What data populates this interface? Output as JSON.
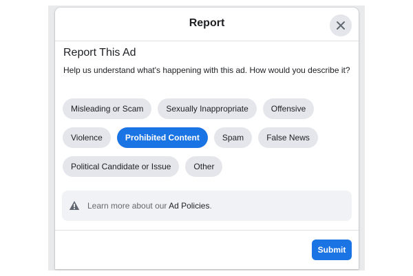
{
  "dialog": {
    "title": "Report",
    "close_icon": "close-icon"
  },
  "section": {
    "title": "Report This Ad",
    "description": "Help us understand what's happening with this ad. How would you describe it?"
  },
  "options": [
    {
      "label": "Misleading or Scam",
      "selected": false
    },
    {
      "label": "Sexually Inappropriate",
      "selected": false
    },
    {
      "label": "Offensive",
      "selected": false
    },
    {
      "label": "Violence",
      "selected": false
    },
    {
      "label": "Prohibited Content",
      "selected": true
    },
    {
      "label": "Spam",
      "selected": false
    },
    {
      "label": "False News",
      "selected": false
    },
    {
      "label": "Political Candidate or Issue",
      "selected": false
    },
    {
      "label": "Other",
      "selected": false
    }
  ],
  "info": {
    "icon": "warning-icon",
    "prefix": "Learn more about our ",
    "link": "Ad Policies",
    "suffix": "."
  },
  "footer": {
    "submit_label": "Submit"
  },
  "colors": {
    "accent": "#1b74e4",
    "chip_bg": "#e4e6eb",
    "info_bg": "#f0f2f5"
  }
}
